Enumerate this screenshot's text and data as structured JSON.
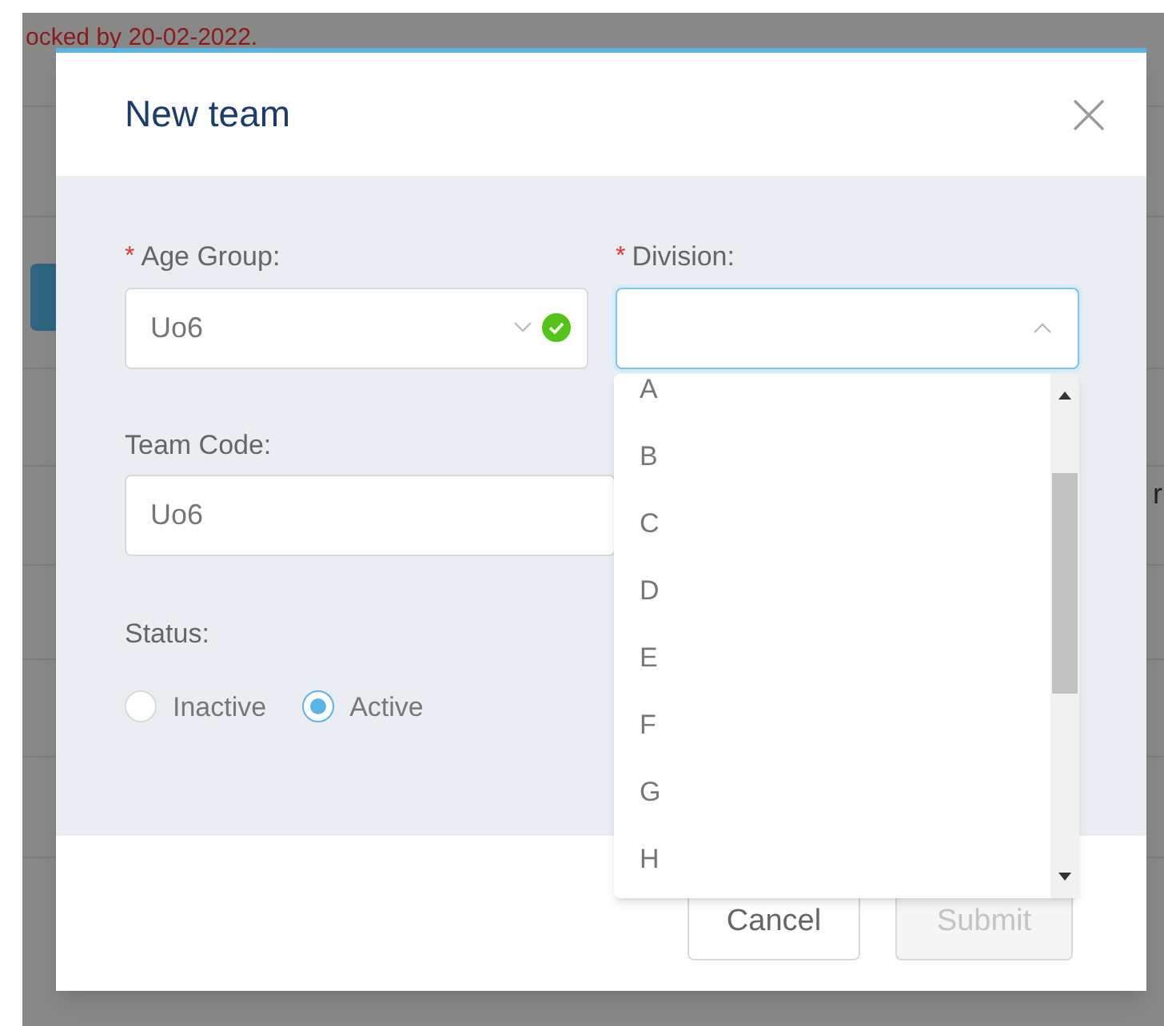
{
  "page": {
    "notice": "ocked by 20-02-2022.",
    "row_fragments": [
      "r"
    ]
  },
  "dialog": {
    "title": "New team",
    "age_group": {
      "required_mark": "*",
      "label": "Age Group:",
      "value": "Uo6",
      "valid": true
    },
    "division": {
      "required_mark": "*",
      "label": "Division:",
      "expanded": true,
      "options": [
        {
          "label": "A",
          "selected": false
        },
        {
          "label": "B",
          "selected": false
        },
        {
          "label": "C",
          "selected": false
        },
        {
          "label": "D",
          "selected": false
        },
        {
          "label": "E",
          "selected": false
        },
        {
          "label": "F",
          "selected": false
        },
        {
          "label": "G",
          "selected": false
        },
        {
          "label": "H",
          "selected": false
        }
      ]
    },
    "team_code": {
      "label": "Team Code:",
      "value": "Uo6"
    },
    "status": {
      "label": "Status:",
      "options": [
        {
          "label": "Inactive",
          "selected": false
        },
        {
          "label": "Active",
          "selected": true
        }
      ]
    },
    "buttons": [
      {
        "label": "Cancel",
        "disabled": false
      },
      {
        "label": "Submit",
        "disabled": true
      }
    ]
  }
}
